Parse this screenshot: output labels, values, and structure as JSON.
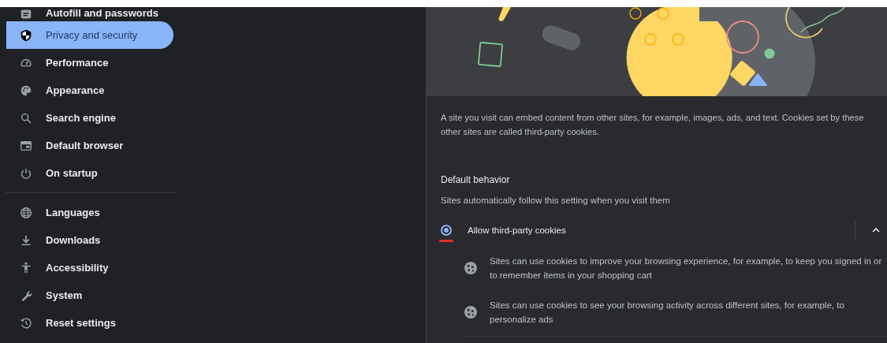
{
  "sidebar": {
    "sections": [
      {
        "items": [
          {
            "label": "Autofill and passwords",
            "selected": false
          },
          {
            "label": "Privacy and security",
            "selected": true
          },
          {
            "label": "Performance",
            "selected": false
          },
          {
            "label": "Appearance",
            "selected": false
          },
          {
            "label": "Search engine",
            "selected": false
          },
          {
            "label": "Default browser",
            "selected": false
          },
          {
            "label": "On startup",
            "selected": false
          }
        ]
      },
      {
        "items": [
          {
            "label": "Languages",
            "selected": false
          },
          {
            "label": "Downloads",
            "selected": false
          },
          {
            "label": "Accessibility",
            "selected": false
          },
          {
            "label": "System",
            "selected": false
          },
          {
            "label": "Reset settings",
            "selected": false
          }
        ]
      }
    ]
  },
  "content": {
    "description": "A site you visit can embed content from other sites, for example, images, ads, and text. Cookies set by these other sites are called third-party cookies.",
    "section_title": "Default behavior",
    "section_subtitle": "Sites automatically follow this setting when you visit them",
    "options": [
      {
        "label": "Allow third-party cookies",
        "selected": true,
        "expanded": true,
        "details": [
          "Sites can use cookies to improve your browsing experience, for example, to keep you signed in or to remember items in your shopping cart",
          "Sites can use cookies to see your browsing activity across different sites, for example, to personalize ads"
        ]
      }
    ]
  }
}
